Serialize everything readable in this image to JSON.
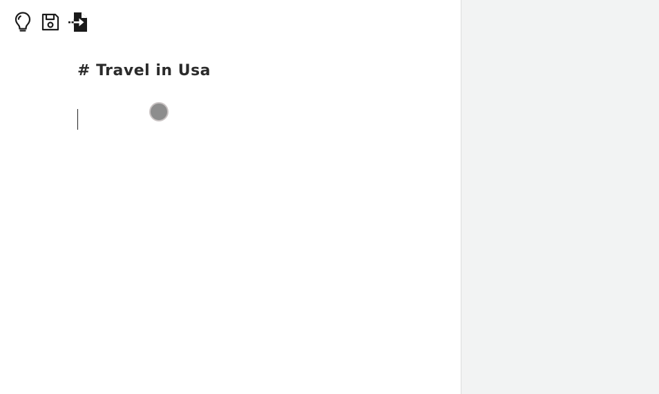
{
  "toolbar": {
    "items": [
      {
        "icon": "lightbulb-icon"
      },
      {
        "icon": "save-icon"
      },
      {
        "icon": "export-file-icon"
      }
    ]
  },
  "document": {
    "heading": "# Travel in Usa",
    "body": ""
  },
  "preview": {
    "content": ""
  }
}
